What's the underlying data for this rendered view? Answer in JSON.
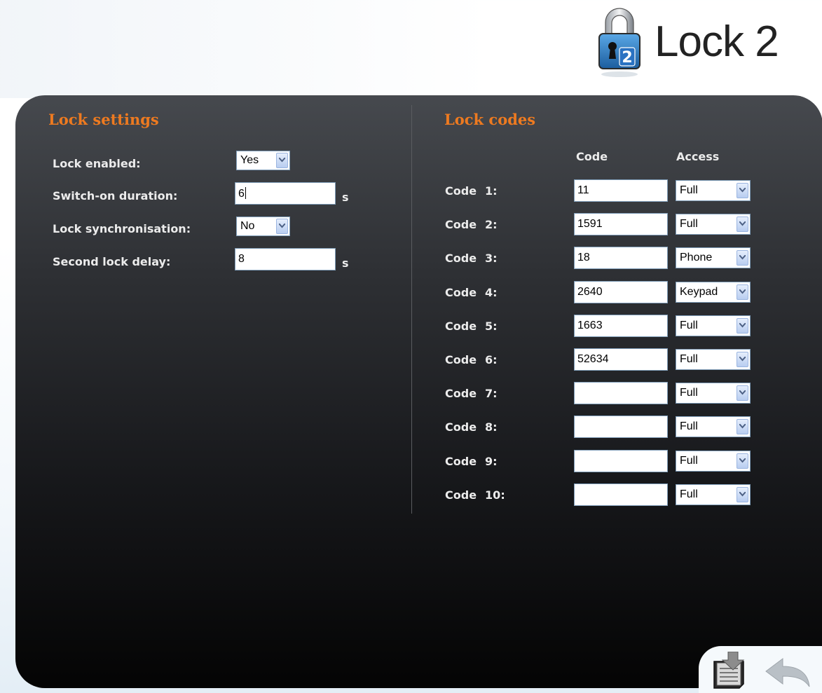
{
  "header": {
    "title": "Lock 2",
    "icon": "padlock-icon",
    "icon_badge": "2"
  },
  "colors": {
    "accent": "#ee7a20",
    "panel_top": "#46494e",
    "panel_bottom": "#040404",
    "label": "#ececec"
  },
  "lock_settings": {
    "title": "Lock settings",
    "lock_enabled": {
      "label": "Lock enabled:",
      "value": "Yes"
    },
    "switch_on_duration": {
      "label": "Switch-on duration:",
      "value": "6",
      "unit": "s"
    },
    "lock_synchronisation": {
      "label": "Lock synchronisation:",
      "value": "No"
    },
    "second_lock_delay": {
      "label": "Second lock delay:",
      "value": "8",
      "unit": "s"
    }
  },
  "lock_codes": {
    "title": "Lock codes",
    "code_header": "Code",
    "access_header": "Access",
    "rows": [
      {
        "label": "Code",
        "number": "1:",
        "code": "11",
        "access": "Full"
      },
      {
        "label": "Code",
        "number": "2:",
        "code": "1591",
        "access": "Full"
      },
      {
        "label": "Code",
        "number": "3:",
        "code": "18",
        "access": "Phone"
      },
      {
        "label": "Code",
        "number": "4:",
        "code": "2640",
        "access": "Keypad"
      },
      {
        "label": "Code",
        "number": "5:",
        "code": "1663",
        "access": "Full"
      },
      {
        "label": "Code",
        "number": "6:",
        "code": "52634",
        "access": "Full"
      },
      {
        "label": "Code",
        "number": "7:",
        "code": "",
        "access": "Full"
      },
      {
        "label": "Code",
        "number": "8:",
        "code": "",
        "access": "Full"
      },
      {
        "label": "Code",
        "number": "9:",
        "code": "",
        "access": "Full"
      },
      {
        "label": "Code",
        "number": "10:",
        "code": "",
        "access": "Full"
      }
    ]
  },
  "footer": {
    "save_icon": "save-icon",
    "back_icon": "back-arrow-icon"
  }
}
